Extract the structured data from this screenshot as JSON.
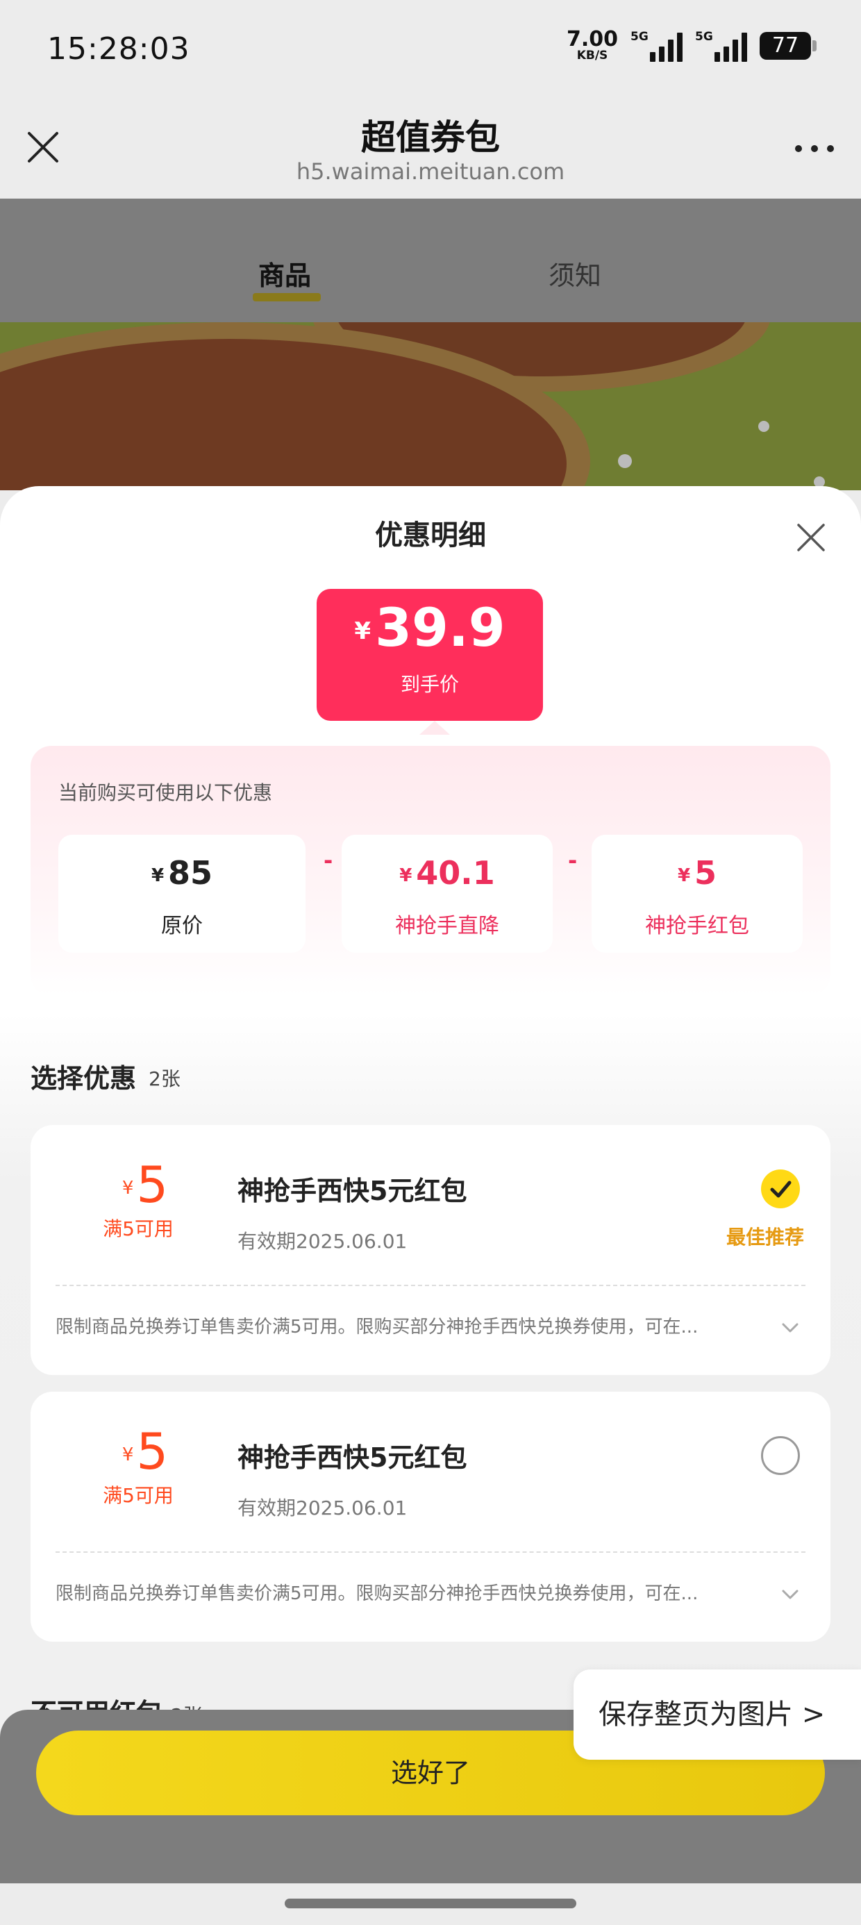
{
  "status_bar": {
    "time": "15:28:03",
    "net_speed_value": "7.00",
    "net_speed_unit": "KB/S",
    "signal_1_tag": "5G",
    "signal_2_tag": "5G",
    "battery": "77"
  },
  "nav": {
    "title": "超值券包",
    "subtitle": "h5.waimai.meituan.com",
    "close_icon": "close-icon",
    "more_icon": "more-dots-icon"
  },
  "page_tabs": [
    {
      "label": "商品",
      "active": true
    },
    {
      "label": "须知",
      "active": false
    }
  ],
  "sheet": {
    "title": "优惠明细",
    "final_price": {
      "currency": "¥",
      "amount": "39.9",
      "label": "到手价"
    },
    "breakdown": {
      "intro": "当前购买可使用以下优惠",
      "items": [
        {
          "currency": "¥",
          "value": "85",
          "label": "原价"
        },
        {
          "currency": "¥",
          "value": "40.1",
          "label": "神抢手直降"
        },
        {
          "currency": "¥",
          "value": "5",
          "label": "神抢手红包"
        }
      ],
      "operator": "-"
    },
    "select": {
      "title": "选择优惠",
      "count": "2张"
    },
    "coupons": [
      {
        "currency": "¥",
        "amount": "5",
        "condition": "满5可用",
        "name": "神抢手西快5元红包",
        "validity": "有效期2025.06.01",
        "selected": true,
        "badge": "最佳推荐",
        "desc": "限制商品兑换券订单售卖价满5可用。限购买部分神抢手西快兑换券使用，可在..."
      },
      {
        "currency": "¥",
        "amount": "5",
        "condition": "满5可用",
        "name": "神抢手西快5元红包",
        "validity": "有效期2025.06.01",
        "selected": false,
        "badge": "",
        "desc": "限制商品兑换券订单售卖价满5可用。限购买部分神抢手西快兑换券使用，可在..."
      }
    ],
    "unavailable": {
      "title": "不可用红包",
      "count": "2张"
    },
    "confirm_label": "选好了"
  },
  "save_page_label": "保存整页为图片 >",
  "colors": {
    "price_pink": "#ff2e5b",
    "coupon_orange": "#ff4a1e",
    "best_badge": "#e69a12",
    "check_yellow": "#ffd915",
    "button_yellow": "#f4d81c"
  }
}
